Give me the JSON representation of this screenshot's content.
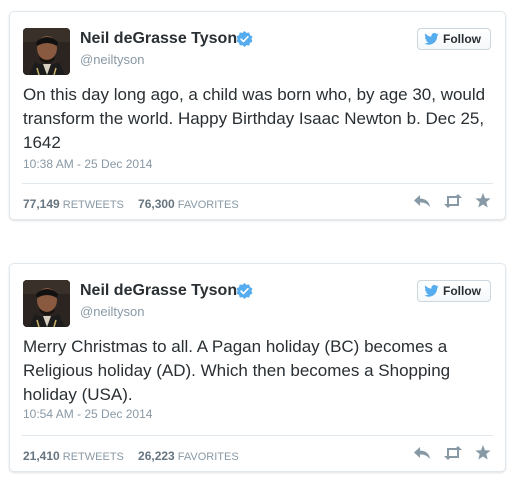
{
  "colors": {
    "text": "#292f33",
    "muted": "#8899a6",
    "verified": "#55acee",
    "twitter_blue": "#55acee",
    "border": "#e1e8ed"
  },
  "tweets": [
    {
      "name": "Neil deGrasse Tyson",
      "handle": "@neiltyson",
      "follow_label": "Follow",
      "text": "On this day long ago, a child was born who, by age 30, would transform the world. Happy Birthday Isaac Newton b. Dec 25, 1642",
      "timestamp": "10:38 AM - 25 Dec 2014",
      "retweets_count": "77,149",
      "retweets_label": "RETWEETS",
      "favorites_count": "76,300",
      "favorites_label": "FAVORITES",
      "icons": [
        "verified-badge-icon",
        "twitter-bird-icon",
        "reply-icon",
        "retweet-icon",
        "favorite-star-icon"
      ]
    },
    {
      "name": "Neil deGrasse Tyson",
      "handle": "@neiltyson",
      "follow_label": "Follow",
      "text": "Merry Christmas to all. A Pagan holiday (BC) becomes a Religious holiday (AD). Which then becomes a Shopping holiday (USA).",
      "timestamp": "10:54 AM - 25 Dec 2014",
      "retweets_count": "21,410",
      "retweets_label": "RETWEETS",
      "favorites_count": "26,223",
      "favorites_label": "FAVORITES",
      "icons": [
        "verified-badge-icon",
        "twitter-bird-icon",
        "reply-icon",
        "retweet-icon",
        "favorite-star-icon"
      ]
    }
  ]
}
